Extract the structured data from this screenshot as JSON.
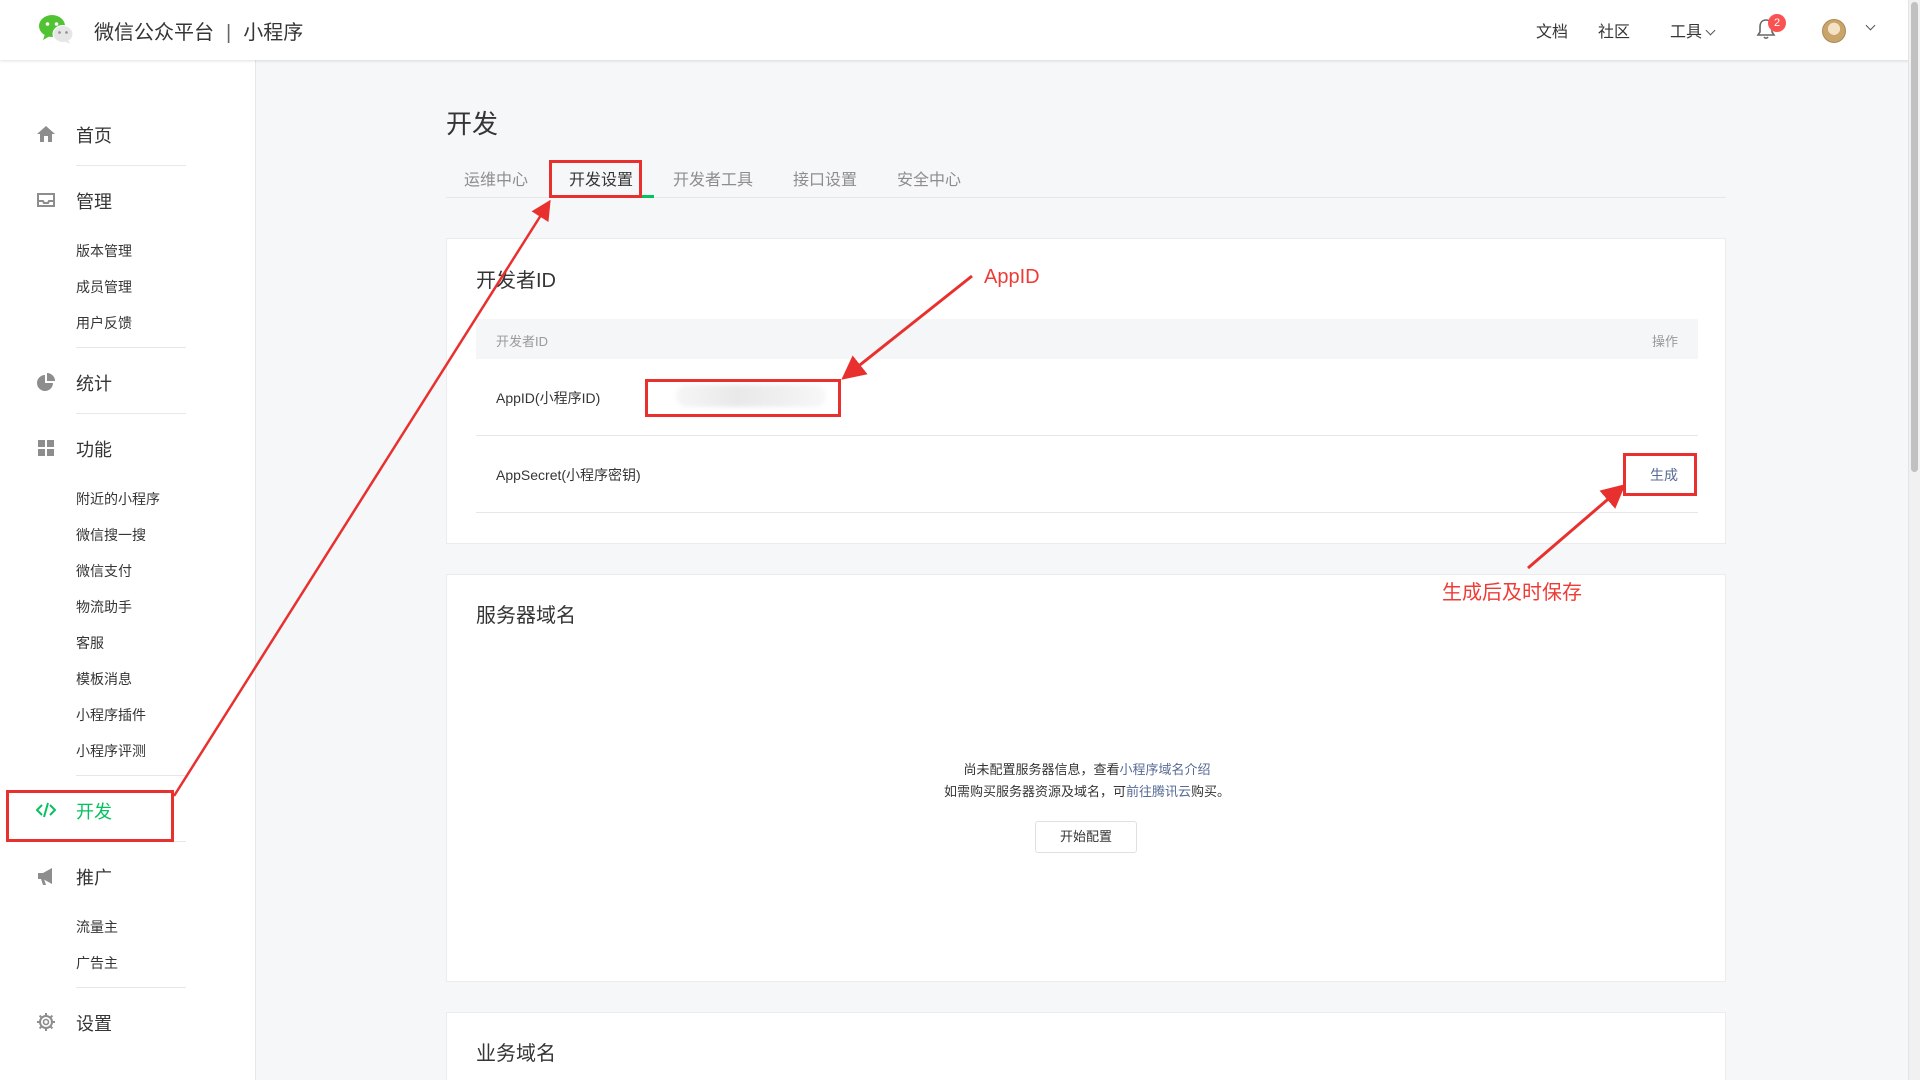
{
  "header": {
    "brand": "微信公众平台",
    "separator": "|",
    "product": "小程序",
    "links": {
      "docs": "文档",
      "community": "社区",
      "tools": "工具"
    },
    "notification_count": "2"
  },
  "sidebar": {
    "home": "首页",
    "manage": {
      "label": "管理",
      "items": [
        "版本管理",
        "成员管理",
        "用户反馈"
      ]
    },
    "stats": "统计",
    "features": {
      "label": "功能",
      "items": [
        "附近的小程序",
        "微信搜一搜",
        "微信支付",
        "物流助手",
        "客服",
        "模板消息",
        "小程序插件",
        "小程序评测"
      ]
    },
    "develop": "开发",
    "promote": {
      "label": "推广",
      "items": [
        "流量主",
        "广告主"
      ]
    },
    "settings": "设置"
  },
  "main": {
    "page_title": "开发",
    "tabs": [
      "运维中心",
      "开发设置",
      "开发者工具",
      "接口设置",
      "安全中心"
    ],
    "active_tab": "开发设置",
    "developer_id": {
      "title": "开发者ID",
      "col_id": "开发者ID",
      "col_action": "操作",
      "appid_label": "AppID(小程序ID)",
      "appsecret_label": "AppSecret(小程序密钥)",
      "generate": "生成"
    },
    "server_domain": {
      "title": "服务器域名",
      "line1_text": "尚未配置服务器信息，查看",
      "line1_link": "小程序域名介绍",
      "line2_text": "如需购买服务器资源及域名，可",
      "line2_link": "前往腾讯云",
      "line2_tail": "购买。",
      "button": "开始配置"
    },
    "business_domain": {
      "title": "业务域名"
    }
  },
  "annotations": {
    "appid": "AppID",
    "save_hint": "生成后及时保存"
  },
  "colors": {
    "accent_green": "#07c160",
    "link_blue": "#576b95",
    "annotation_red": "#e8312f",
    "badge_red": "#fa5151"
  }
}
